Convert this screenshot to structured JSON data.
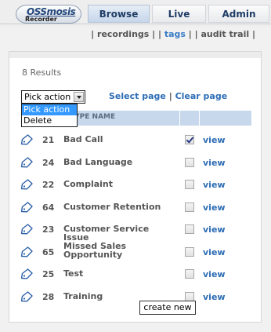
{
  "app": {
    "logo_text": "OSSmosis",
    "logo_sub": "Recorder"
  },
  "tabs": [
    {
      "label": "Browse",
      "active": true
    },
    {
      "label": "Live",
      "active": false
    },
    {
      "label": "Admin",
      "active": false
    }
  ],
  "subnav": {
    "items": [
      {
        "label": "recordings",
        "active": false
      },
      {
        "label": "tags",
        "active": true
      },
      {
        "label": "audit trail",
        "active": false
      }
    ]
  },
  "results_text": "8 Results",
  "action_select": {
    "value": "Pick action",
    "options": [
      "Pick action",
      "Delete"
    ],
    "highlighted": "Pick action"
  },
  "page_links": {
    "select_page": "Select page",
    "separator": "|",
    "clear_page": "Clear page"
  },
  "table": {
    "header_label": "TYPE NAME",
    "rows": [
      {
        "id": "21",
        "name": "Bad Call",
        "checked": true,
        "action": "view"
      },
      {
        "id": "24",
        "name": "Bad Language",
        "checked": false,
        "action": "view"
      },
      {
        "id": "22",
        "name": "Complaint",
        "checked": false,
        "action": "view"
      },
      {
        "id": "64",
        "name": "Customer Retention",
        "checked": false,
        "action": "view"
      },
      {
        "id": "23",
        "name": "Customer Service Issue",
        "checked": false,
        "action": "view"
      },
      {
        "id": "65",
        "name": "Missed Sales Opportunity",
        "checked": false,
        "action": "view"
      },
      {
        "id": "25",
        "name": "Test",
        "checked": false,
        "action": "view"
      },
      {
        "id": "28",
        "name": "Training",
        "checked": false,
        "action": "view"
      }
    ]
  },
  "create_button": "create new",
  "colors": {
    "link": "#2d6db5",
    "header_bg": "#c7d8ec",
    "active_subnav": "#3a7cc6",
    "highlight": "#3399ff"
  }
}
